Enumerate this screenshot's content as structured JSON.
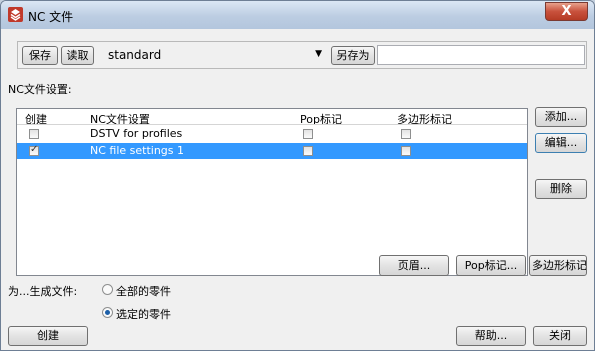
{
  "window": {
    "title": "NC 文件",
    "close_glyph": "X",
    "app_icon": "stacked-diamond-logo"
  },
  "toolbar": {
    "save_label": "保存",
    "load_label": "读取",
    "settings_value": "standard",
    "save_as_label": "另存为",
    "save_as_value": ""
  },
  "section_label": "NC文件设置:",
  "table": {
    "columns": [
      "创建",
      "NC文件设置",
      "Pop标记",
      "多边形标记"
    ],
    "rows": [
      {
        "create": false,
        "name": "DSTV for profiles",
        "pop": false,
        "polygon": false,
        "selected": false
      },
      {
        "create": true,
        "name": "NC file settings 1",
        "pop": false,
        "polygon": false,
        "selected": true
      }
    ]
  },
  "side_buttons": {
    "add": "添加...",
    "edit": "编辑...",
    "delete": "删除"
  },
  "bottom_buttons": {
    "header": "页眉...",
    "pop_mark": "Pop标记...",
    "polygon_mark": "多边形标记..."
  },
  "generate": {
    "label": "为...生成文件:",
    "options": [
      "全部的零件",
      "选定的零件"
    ],
    "selected_index": 1
  },
  "footer": {
    "create": "创建",
    "help": "帮助...",
    "close": "关闭"
  },
  "colors": {
    "selection": "#3399ff",
    "titlebar": "#bccde2",
    "close_button": "#c8513c"
  }
}
